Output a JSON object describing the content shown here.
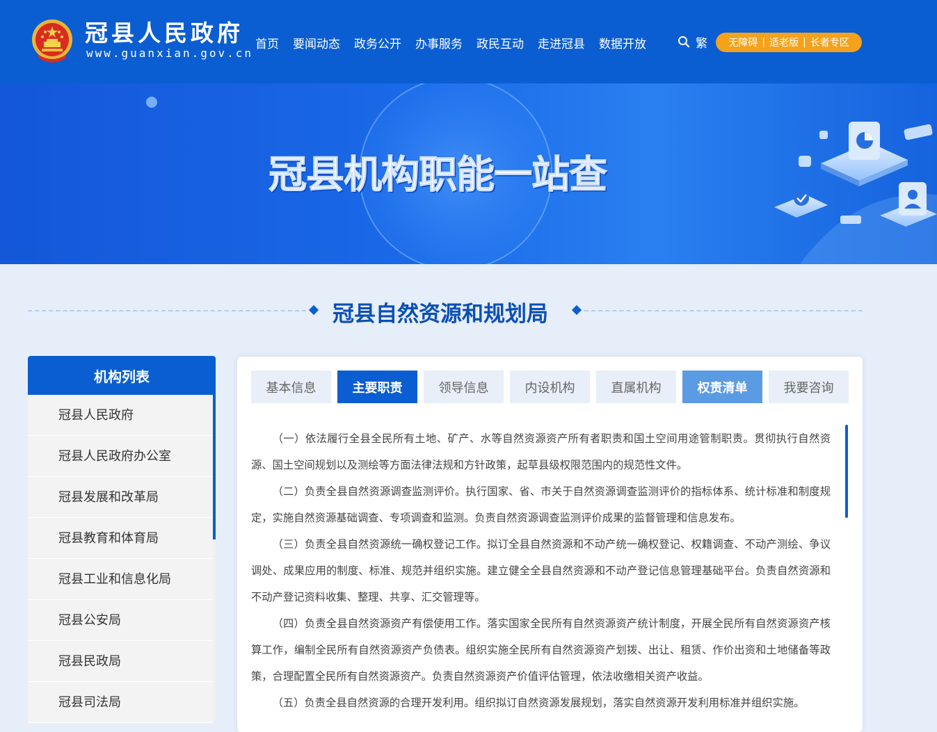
{
  "header": {
    "site_name": "冠县人民政府",
    "site_url": "www.guanxian.gov.cn",
    "nav": [
      "首页",
      "要闻动态",
      "政务公开",
      "办事服务",
      "政民互动",
      "走进冠县",
      "数据开放"
    ],
    "traditional": "繁",
    "accessibility": [
      "无障碍",
      "适老版",
      "长者专区"
    ],
    "accessibility_separator": "|"
  },
  "banner": {
    "title": "冠县机构职能一站查"
  },
  "section": {
    "title": "冠县自然资源和规划局"
  },
  "sidebar": {
    "title": "机构列表",
    "items": [
      "冠县人民政府",
      "冠县人民政府办公室",
      "冠县发展和改革局",
      "冠县教育和体育局",
      "冠县工业和信息化局",
      "冠县公安局",
      "冠县民政局",
      "冠县司法局"
    ]
  },
  "tabs": [
    {
      "label": "基本信息",
      "state": "normal"
    },
    {
      "label": "主要职责",
      "state": "active"
    },
    {
      "label": "领导信息",
      "state": "normal"
    },
    {
      "label": "内设机构",
      "state": "normal"
    },
    {
      "label": "直属机构",
      "state": "normal"
    },
    {
      "label": "权责清单",
      "state": "highlight"
    },
    {
      "label": "我要咨询",
      "state": "normal"
    }
  ],
  "content": {
    "paragraphs": [
      "（一）依法履行全县全民所有土地、矿产、水等自然资源资产所有者职责和国土空间用途管制职责。贯彻执行自然资源、国土空间规划以及测绘等方面法律法规和方针政策，起草县级权限范围内的规范性文件。",
      "（二）负责全县自然资源调查监测评价。执行国家、省、市关于自然资源调查监测评价的指标体系、统计标准和制度规定，实施自然资源基础调查、专项调查和监测。负责自然资源调查监测评价成果的监督管理和信息发布。",
      "（三）负责全县自然资源统一确权登记工作。拟订全县自然资源和不动产统一确权登记、权籍调查、不动产测绘、争议调处、成果应用的制度、标准、规范并组织实施。建立健全全县自然资源和不动产登记信息管理基础平台。负责自然资源和不动产登记资料收集、整理、共享、汇交管理等。",
      "（四）负责全县自然资源资产有偿使用工作。落实国家全民所有自然资源资产统计制度，开展全民所有自然资源资产核算工作，编制全民所有自然资源资产负债表。组织实施全民所有自然资源资产划拨、出让、租赁、作价出资和土地储备等政策，合理配置全民所有自然资源资产。负责自然资源资产价值评估管理，依法收缴相关资产收益。",
      "（五）负责全县自然资源的合理开发利用。组织拟订自然资源发展规划，落实自然资源开发利用标准并组织实施。"
    ]
  },
  "colors": {
    "primary": "#0a5ed1",
    "accent_orange": "#f4a21c",
    "page_bg": "#e6eefa",
    "tab_inactive_bg": "#e8eff8",
    "tab_highlight_bg": "#5b9be3"
  },
  "icons": [
    "national-emblem-icon",
    "search-icon"
  ]
}
